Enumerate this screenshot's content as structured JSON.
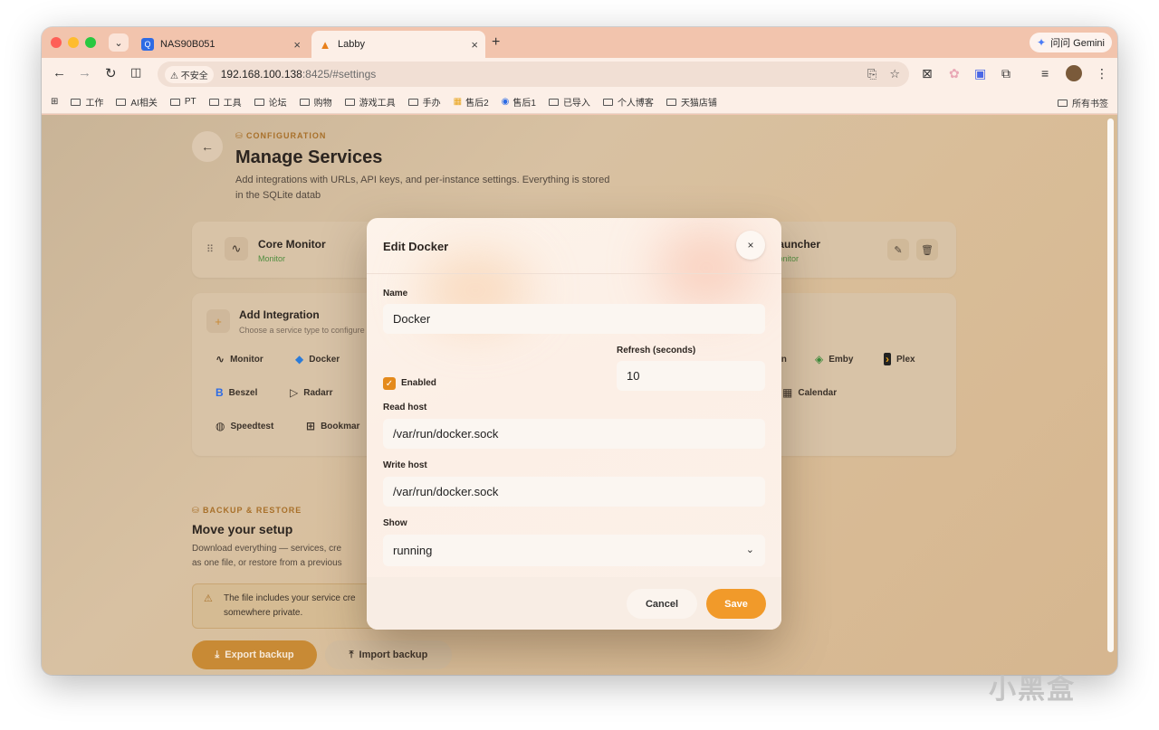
{
  "browser": {
    "tabs": [
      {
        "title": "NAS90B051",
        "favicon": "Q"
      },
      {
        "title": "Labby",
        "favicon": "flask-icon"
      }
    ],
    "tab_close": "×",
    "new_tab": "+",
    "gemini_label": "问问 Gemini",
    "insecure_label": "不安全",
    "url_host": "192.168.100.138",
    "url_rest": ":8425/#settings",
    "bookmarks": [
      "工作",
      "AI相关",
      "PT",
      "工具",
      "论坛",
      "购物",
      "游戏工具",
      "手办",
      "售后2",
      "售后1",
      "已导入",
      "个人博客",
      "天猫店铺"
    ],
    "bookmarks_right": "所有书签"
  },
  "page": {
    "eyebrow": "CONFIGURATION",
    "title": "Manage Services",
    "subtitle": "Add integrations with URLs, API keys, and per-instance settings. Everything is stored in the SQLite datab",
    "services": [
      {
        "name": "Core Monitor",
        "type": "Monitor"
      },
      {
        "name": "Launcher",
        "type": "Monitor"
      }
    ],
    "add_integration": {
      "title": "Add Integration",
      "subtitle": "Choose a service type to configure",
      "pills": [
        "Monitor",
        "Docker",
        "in",
        "Emby",
        "Plex",
        "Beszel",
        "Radarr",
        "Calendar",
        "Speedtest",
        "Bookmar"
      ]
    },
    "backup": {
      "eyebrow": "BACKUP & RESTORE",
      "title": "Move your setup",
      "line1": "Download everything — services, cre",
      "line2": "as one file, or restore from a previous",
      "warning_line1": "The file includes your service cre",
      "warning_line2": "somewhere private.",
      "export_label": "Export backup",
      "import_label": "Import backup"
    }
  },
  "modal": {
    "title": "Edit Docker",
    "close": "×",
    "name_label": "Name",
    "name_value": "Docker",
    "refresh_label": "Refresh (seconds)",
    "refresh_value": "10",
    "enabled_label": "Enabled",
    "enabled": true,
    "read_host_label": "Read host",
    "read_host_value": "/var/run/docker.sock",
    "write_host_label": "Write host",
    "write_host_value": "/var/run/docker.sock",
    "show_label": "Show",
    "show_value": "running",
    "cancel_label": "Cancel",
    "save_label": "Save"
  },
  "watermark": "小黑盒",
  "colors": {
    "accent": "#f19a2a",
    "checkbox": "#e48a1c",
    "eyebrow": "#a8702a"
  }
}
